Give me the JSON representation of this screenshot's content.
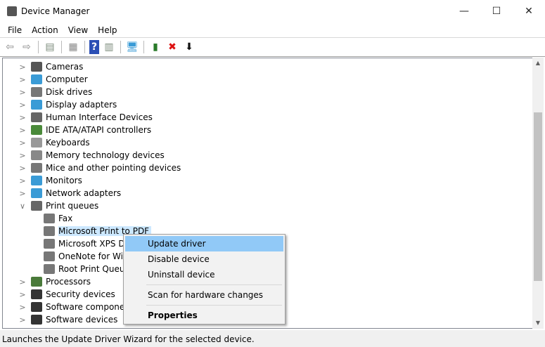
{
  "window": {
    "title": "Device Manager",
    "minimize": "—",
    "maximize": "☐",
    "close": "✕"
  },
  "menu": [
    "File",
    "Action",
    "View",
    "Help"
  ],
  "toolbar": [
    {
      "name": "back-icon",
      "glyph": "⇦",
      "color": "#8a8a8a"
    },
    {
      "name": "forward-icon",
      "glyph": "⇨",
      "color": "#8a8a8a"
    },
    {
      "sep": true
    },
    {
      "name": "show-hide-console-tree-icon",
      "glyph": "▤",
      "color": "#7a8a7a"
    },
    {
      "sep": true
    },
    {
      "name": "properties-icon",
      "glyph": "▦",
      "color": "#888"
    },
    {
      "sep": true
    },
    {
      "name": "help-icon",
      "glyph": "?",
      "color": "#fff",
      "bg": "#2b4fb5"
    },
    {
      "name": "show-action-pane-icon",
      "glyph": "▥",
      "color": "#7a8a7a"
    },
    {
      "sep": true
    },
    {
      "name": "scan-hardware-icon",
      "glyph": "🖥",
      "color": "#3a9bd6"
    },
    {
      "sep": true
    },
    {
      "name": "update-driver-icon",
      "glyph": "▮",
      "color": "#2a7a2a"
    },
    {
      "name": "uninstall-icon",
      "glyph": "✖",
      "color": "#d11"
    },
    {
      "name": "download-icon",
      "glyph": "⬇",
      "color": "#111"
    }
  ],
  "tree": [
    {
      "label": "Cameras",
      "level": 0,
      "exp": ">",
      "color": "#555"
    },
    {
      "label": "Computer",
      "level": 0,
      "exp": ">",
      "color": "#3a9bd6"
    },
    {
      "label": "Disk drives",
      "level": 0,
      "exp": ">",
      "color": "#777"
    },
    {
      "label": "Display adapters",
      "level": 0,
      "exp": ">",
      "color": "#3a9bd6"
    },
    {
      "label": "Human Interface Devices",
      "level": 0,
      "exp": ">",
      "color": "#666"
    },
    {
      "label": "IDE ATA/ATAPI controllers",
      "level": 0,
      "exp": ">",
      "color": "#4a8a3a"
    },
    {
      "label": "Keyboards",
      "level": 0,
      "exp": ">",
      "color": "#999"
    },
    {
      "label": "Memory technology devices",
      "level": 0,
      "exp": ">",
      "color": "#888"
    },
    {
      "label": "Mice and other pointing devices",
      "level": 0,
      "exp": ">",
      "color": "#777"
    },
    {
      "label": "Monitors",
      "level": 0,
      "exp": ">",
      "color": "#3a9bd6"
    },
    {
      "label": "Network adapters",
      "level": 0,
      "exp": ">",
      "color": "#3a9bd6"
    },
    {
      "label": "Print queues",
      "level": 0,
      "exp": "∨",
      "color": "#666"
    },
    {
      "label": "Fax",
      "level": 1,
      "exp": "",
      "color": "#777"
    },
    {
      "label": "Microsoft Print to PDF",
      "level": 1,
      "exp": "",
      "color": "#777",
      "selected": true
    },
    {
      "label": "Microsoft XPS Dc",
      "level": 1,
      "exp": "",
      "color": "#777"
    },
    {
      "label": "OneNote for Win",
      "level": 1,
      "exp": "",
      "color": "#777"
    },
    {
      "label": "Root Print Queue",
      "level": 1,
      "exp": "",
      "color": "#777"
    },
    {
      "label": "Processors",
      "level": 0,
      "exp": ">",
      "color": "#4a7a3a"
    },
    {
      "label": "Security devices",
      "level": 0,
      "exp": ">",
      "color": "#333"
    },
    {
      "label": "Software component",
      "level": 0,
      "exp": ">",
      "color": "#333"
    },
    {
      "label": "Software devices",
      "level": 0,
      "exp": ">",
      "color": "#333"
    }
  ],
  "context_menu": {
    "items": [
      {
        "label": "Update driver",
        "highlighted": true
      },
      {
        "label": "Disable device"
      },
      {
        "label": "Uninstall device"
      },
      {
        "sep": true
      },
      {
        "label": "Scan for hardware changes"
      },
      {
        "sep": true
      },
      {
        "label": "Properties",
        "bold": true
      }
    ]
  },
  "status": "Launches the Update Driver Wizard for the selected device."
}
